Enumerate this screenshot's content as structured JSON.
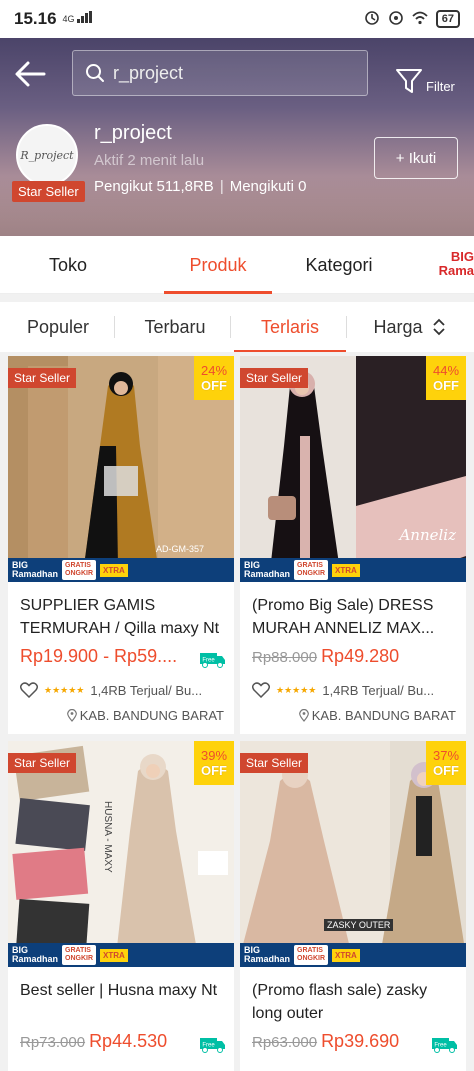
{
  "status_bar": {
    "time": "15.16",
    "network": "4G",
    "battery": "67"
  },
  "header": {
    "search_text": "r_project",
    "filter_label": "Filter",
    "shop": {
      "name": "r_project",
      "logo_text": "R_project",
      "star_badge": "Star Seller",
      "active": "Aktif 2 menit lalu",
      "followers": "Pengikut 511,8RB",
      "following": "Mengikuti 0",
      "follow_label": "+ Ikuti"
    }
  },
  "tabs": [
    {
      "label": "Toko"
    },
    {
      "label": "Produk",
      "active": true
    },
    {
      "label": "Kategori"
    }
  ],
  "promo_logo": "BIG Rama",
  "sort": [
    {
      "label": "Populer"
    },
    {
      "label": "Terbaru"
    },
    {
      "label": "Terlaris",
      "active": true
    },
    {
      "label": "Harga"
    }
  ],
  "strip": {
    "big": "BIG",
    "ramadhan": "Ramadhan",
    "gratis": "GRATIS",
    "ongkir": "ONGKIR",
    "xtra": "XTRA"
  },
  "products": [
    {
      "star_badge": "Star Seller",
      "discount": "24%",
      "off": "OFF",
      "image_text": "AD-GM-357",
      "title": "SUPPLIER GAMIS TERMURAH / Qilla maxy Nt",
      "price_old": "",
      "price": "Rp19.900 - Rp59....",
      "free_ship": "Free",
      "sold": "1,4RB Terjual/ Bu...",
      "location": "KAB. BANDUNG BARAT"
    },
    {
      "star_badge": "Star Seller",
      "discount": "44%",
      "off": "OFF",
      "image_text": "Anneliz",
      "title": "(Promo Big Sale) DRESS MURAH ANNELIZ MAX...",
      "price_old": "Rp88.000",
      "price": "Rp49.280",
      "free_ship": "",
      "sold": "1,4RB Terjual/ Bu...",
      "location": "KAB. BANDUNG BARAT"
    },
    {
      "star_badge": "Star Seller",
      "discount": "39%",
      "off": "OFF",
      "image_text": "HUSNA - MAXY",
      "title": "Best seller | Husna maxy Nt",
      "price_old": "Rp73.000",
      "price": "Rp44.530",
      "free_ship": "Free",
      "sold": "",
      "location": ""
    },
    {
      "star_badge": "Star Seller",
      "discount": "37%",
      "off": "OFF",
      "image_text": "ZASKY OUTER",
      "title": "(Promo flash sale) zasky long outer",
      "price_old": "Rp63.000",
      "price": "Rp39.690",
      "free_ship": "Free",
      "sold": "",
      "location": ""
    }
  ],
  "colors": {
    "accent": "#ee4d2d",
    "star_badge": "#d0472f",
    "discount_bg": "#fed20b"
  }
}
